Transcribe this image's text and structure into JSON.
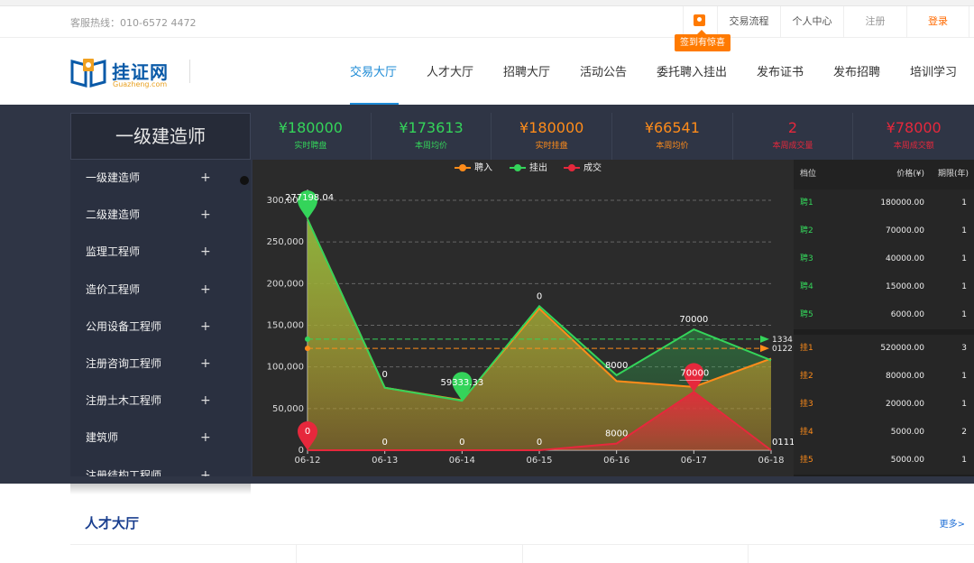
{
  "topbar": {
    "hotline": "客服热线：010-6572 4472",
    "gift_tip": "签到有惊喜",
    "links": [
      "交易流程",
      "个人中心",
      "注册",
      "登录"
    ]
  },
  "header": {
    "logo_text": "挂证网",
    "logo_sub": "Guazheng.com",
    "nav": [
      "交易大厅",
      "人才大厅",
      "招聘大厅",
      "活动公告",
      "委托聘入挂出",
      "发布证书",
      "发布招聘",
      "培训学习"
    ],
    "active_nav": "交易大厅"
  },
  "hall": {
    "cert_title": "一级建造师",
    "stats": [
      {
        "value": "¥180000",
        "label": "实时聘盘",
        "color": "green"
      },
      {
        "value": "¥173613",
        "label": "本周均价",
        "color": "green"
      },
      {
        "value": "¥180000",
        "label": "实时挂盘",
        "color": "orange"
      },
      {
        "value": "¥66541",
        "label": "本周均价",
        "color": "orange"
      },
      {
        "value": "2",
        "label": "本周成交量",
        "color": "red"
      },
      {
        "value": "¥78000",
        "label": "本周成交额",
        "color": "red"
      }
    ],
    "categories": [
      "一级建造师",
      "二级建造师",
      "监理工程师",
      "造价工程师",
      "公用设备工程师",
      "注册咨询工程师",
      "注册土木工程师",
      "建筑师",
      "注册结构工程师"
    ],
    "plus": "+"
  },
  "chart_data": {
    "type": "area",
    "legend": [
      "聘入",
      "挂出",
      "成交"
    ],
    "legend_position": "top-center",
    "categories": [
      "06-12",
      "06-13",
      "06-14",
      "06-15",
      "06-16",
      "06-17",
      "06-18"
    ],
    "ylim": [
      0,
      300000
    ],
    "yticks": [
      "0",
      "50,000",
      "100,000",
      "150,000",
      "200,000",
      "250,000",
      "300,000"
    ],
    "series": [
      {
        "name": "聘入",
        "color": "#ff8c1a",
        "values": [
          277198.04,
          75000,
          60000,
          170000,
          83000,
          76000,
          110000
        ]
      },
      {
        "name": "挂出",
        "color": "#34d45a",
        "values": [
          277198.04,
          75000,
          59333.33,
          173000,
          90000,
          145000,
          108000
        ]
      },
      {
        "name": "成交",
        "color": "#e6283c",
        "values": [
          0,
          0,
          0,
          0,
          8000,
          70000,
          0
        ]
      }
    ],
    "point_labels": [
      {
        "x": "06-12",
        "text": "277198.04",
        "series": "挂出"
      },
      {
        "x": "06-13",
        "text": "0"
      },
      {
        "x": "06-14",
        "text": "59333.33",
        "series": "挂出"
      },
      {
        "x": "06-15",
        "text": "0"
      },
      {
        "x": "06-16",
        "text": "8000"
      },
      {
        "x": "06-17",
        "text": "70000"
      },
      {
        "x": "06-17",
        "text": "70000",
        "series": "成交"
      },
      {
        "x": "06-12",
        "text": "0",
        "series": "成交"
      },
      {
        "x": "06-13",
        "text": "0",
        "series": "成交"
      },
      {
        "x": "06-14",
        "text": "0",
        "series": "成交"
      },
      {
        "x": "06-15",
        "text": "0",
        "series": "成交"
      },
      {
        "x": "06-16",
        "text": "8000",
        "series": "成交"
      },
      {
        "x": "06-18",
        "text": "0111",
        "series": "成交"
      }
    ],
    "reference_lines": [
      {
        "value": 133400,
        "text": "1334",
        "color": "#34d45a"
      },
      {
        "value": 122200,
        "text": "0122",
        "color": "#ff8c1a"
      }
    ]
  },
  "price_panel": {
    "headers": [
      "档位",
      "价格(¥)",
      "期限(年)"
    ],
    "buy": [
      {
        "level": "聘1",
        "price": "180000.00",
        "term": "1"
      },
      {
        "level": "聘2",
        "price": "70000.00",
        "term": "1"
      },
      {
        "level": "聘3",
        "price": "40000.00",
        "term": "1"
      },
      {
        "level": "聘4",
        "price": "15000.00",
        "term": "1"
      },
      {
        "level": "聘5",
        "price": "6000.00",
        "term": "1"
      }
    ],
    "sell": [
      {
        "level": "挂1",
        "price": "520000.00",
        "term": "3"
      },
      {
        "level": "挂2",
        "price": "80000.00",
        "term": "1"
      },
      {
        "level": "挂3",
        "price": "20000.00",
        "term": "1"
      },
      {
        "level": "挂4",
        "price": "5000.00",
        "term": "2"
      },
      {
        "level": "挂5",
        "price": "5000.00",
        "term": "1"
      }
    ]
  },
  "talent": {
    "title": "人才大厅",
    "more": "更多>"
  }
}
